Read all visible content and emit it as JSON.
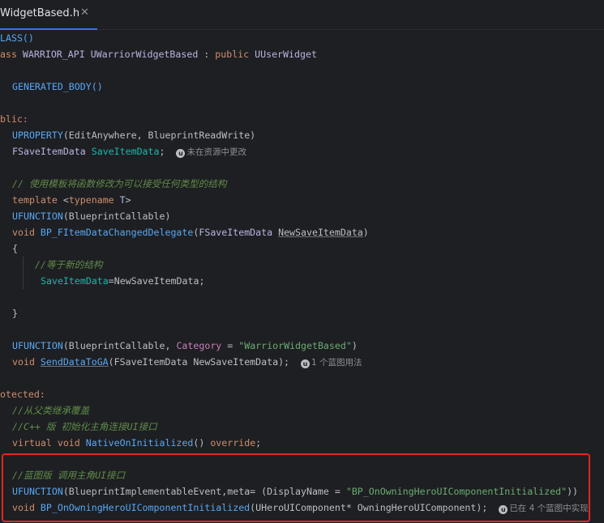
{
  "tab": {
    "title": "WidgetBased.h",
    "close": "✕"
  },
  "code": {
    "l1": "LASS()",
    "l2_kw": "ass ",
    "l2_api": "WARRIOR_API ",
    "l2_cls": "UWarriorWidgetBased",
    "l2_mid": " : ",
    "l2_pub": "public ",
    "l2_base": "UUserWidget",
    "l3": "GENERATED_BODY()",
    "l4": "blic:",
    "l5_mac": "UPROPERTY",
    "l5_args": "(EditAnywhere, BlueprintReadWrite)",
    "l6_type": "FSaveItemData ",
    "l6_var": "SaveItemData",
    "l6_end": ";",
    "l6_hint": "未在资源中更改",
    "l7": "// 使用模板将函数修改为可以接受任何类型的结构",
    "l8_kw": "template ",
    "l8_lt": "<",
    "l8_kw2": "typename ",
    "l8_t": "T",
    "l8_gt": ">",
    "l9_mac": "UFUNCTION",
    "l9_args": "(BlueprintCallable)",
    "l10_kw": "void ",
    "l10_fn": "BP_FItemDataChangedDelegate",
    "l10_p1": "(",
    "l10_type": "FSaveItemData ",
    "l10_param": "NewSaveItemData",
    "l10_p2": ")",
    "l11": "{",
    "l12": "//等于新的结构",
    "l13_var": "SaveItemData",
    "l13_rest": "=NewSaveItemData;",
    "l14": "}",
    "l15_mac": "UFUNCTION",
    "l15_a": "(BlueprintCallable, ",
    "l15_cat": "Category",
    "l15_eq": " = ",
    "l15_str": "\"WarriorWidgetBased\"",
    "l15_c": ")",
    "l16_kw": "void ",
    "l16_fn": "SendDataToGA",
    "l16_rest": "(FSaveItemData NewSaveItemData);",
    "l16_hint": "1 个蓝图用法",
    "l17": "otected:",
    "l18": "//从父类继承覆盖",
    "l19": "//C++ 版 初始化主角连接UI接口",
    "l20_kw": "virtual void ",
    "l20_fn": "NativeOnInitialized",
    "l20_p": "() ",
    "l20_ov": "override",
    "l20_end": ";",
    "l21": "//蓝图版 调用主角UI接口",
    "l22_mac": "UFUNCTION",
    "l22_a": "(BlueprintImplementableEvent,meta= (DisplayName = ",
    "l22_str": "\"BP_OnOwningHeroUIComponentInitialized\"",
    "l22_c": "))",
    "l23_kw": "void ",
    "l23_fn": "BP_OnOwningHeroUIComponentInitialized",
    "l23_p1": "(UHeroUIComponent* OwningHeroUIComponent);",
    "l23_hint": "已在 4 个蓝图中实现"
  },
  "colors": {
    "background": "#1e1f22",
    "highlight": "#e0261f",
    "tab_accent": "#3574f0"
  },
  "icons": {
    "unreal": "unreal-u-icon"
  }
}
